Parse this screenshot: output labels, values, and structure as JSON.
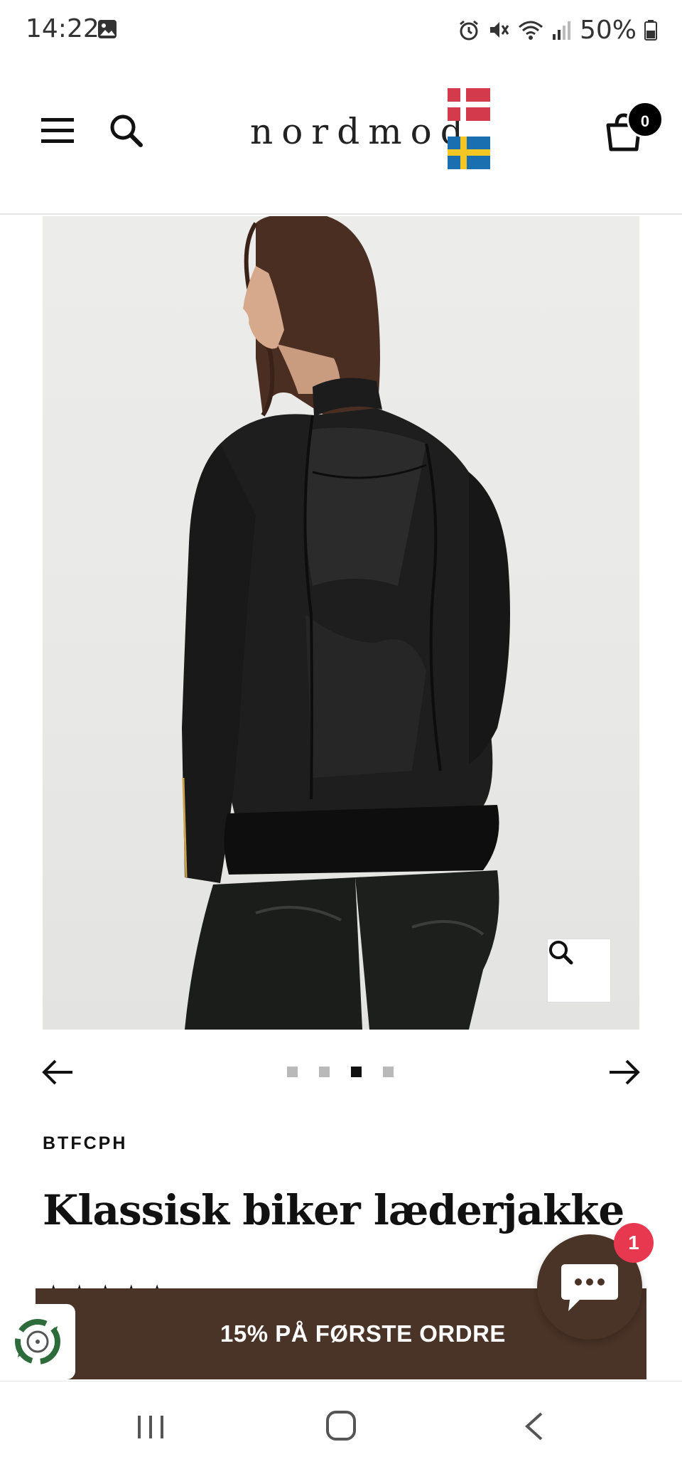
{
  "status_bar": {
    "time": "14:22",
    "battery": "50%",
    "icons": [
      "image-icon",
      "alarm-icon",
      "mute-icon",
      "wifi-icon",
      "signal-icon",
      "battery-icon"
    ]
  },
  "header": {
    "logo": "nordmod",
    "flags": [
      "denmark-flag",
      "sweden-flag"
    ],
    "cart_count": "0",
    "colors": {
      "dk_red": "#c8102e",
      "se_blue": "#006aa7",
      "se_yellow": "#fecc00"
    }
  },
  "gallery": {
    "image_alt": "Woman wearing black leather biker jacket, back view",
    "image_count": 4,
    "active_index": 3
  },
  "product": {
    "brand": "BTFCPH",
    "title": "Klassisk biker læderjakke",
    "stars": "★★★★★"
  },
  "promo": {
    "label": "15% PÅ FØRSTE ORDRE",
    "background": "#4a3327"
  },
  "chat": {
    "badge_count": "1"
  }
}
